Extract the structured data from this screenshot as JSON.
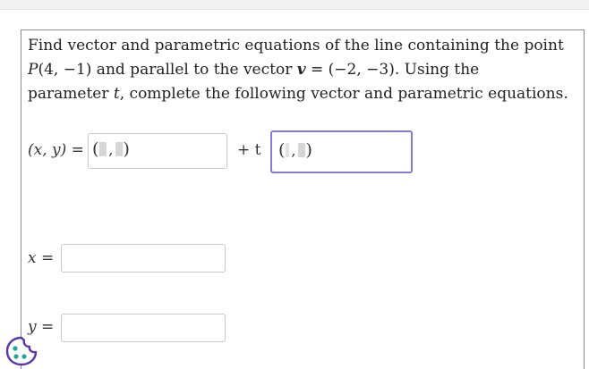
{
  "question": {
    "line1": "Find vector and parametric equations of the line containing the point",
    "line2_point_label": "P",
    "line2_point_value": "(4, −1)",
    "line2_mid": " and parallel to the vector ",
    "vector_symbol": "v",
    "line2_vector_value": " = (−2, −3). Using the",
    "line3_pre": "parameter ",
    "param_symbol": "t",
    "line3_post": ", complete the following vector and parametric equations."
  },
  "equations": {
    "vector_label": "(x, y) =",
    "plus_t_label": "+ t",
    "x_label": "x =",
    "y_label": "y ="
  },
  "tuple_glyphs": {
    "open": "(",
    "comma": ",",
    "close": ")"
  },
  "inputs": {
    "position_value": "",
    "direction_value": "",
    "x_value": "",
    "y_value": ""
  },
  "colors": {
    "focus_border": "#8a78d6",
    "input_border": "#c9c9c9",
    "slot_fill": "#d6d6d6"
  },
  "icons": {
    "help": "cookie-icon"
  }
}
